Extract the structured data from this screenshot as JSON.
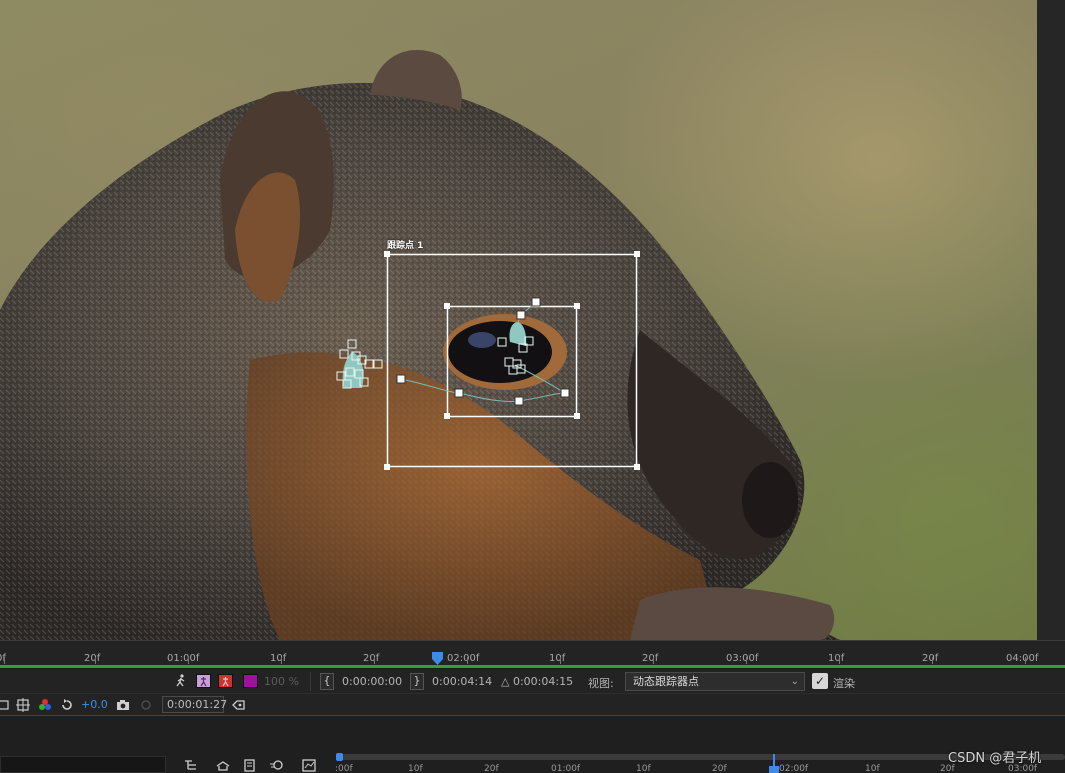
{
  "viewer": {
    "track_point_label": "跟踪点 1"
  },
  "ruler": {
    "labels": [
      "0f",
      "20f",
      "01:00f",
      "10f",
      "20f",
      "02:00f",
      "10f",
      "20f",
      "03:00f",
      "10f",
      "20f",
      "04:00f"
    ]
  },
  "controls": {
    "resolution_percent": "100 %",
    "in_point": "0:00:00:00",
    "out_point": "0:00:04:14",
    "duration": "△ 0:00:04:15",
    "view_label": "视图:",
    "view_value": "动态跟踪器点",
    "render_label": "渲染",
    "render_checked": true,
    "swatch_colors": [
      "#c8a0d8",
      "#d33030",
      "#a010a0"
    ]
  },
  "row2": {
    "exposure": "+0.0",
    "current_time": "0:00:01:27"
  },
  "timeline": {
    "ruler_labels": [
      ":00f",
      "10f",
      "20f",
      "01:00f",
      "10f",
      "20f",
      "02:00f",
      "10f",
      "20f",
      "03:00f"
    ]
  },
  "watermark": "CSDN @君子机"
}
